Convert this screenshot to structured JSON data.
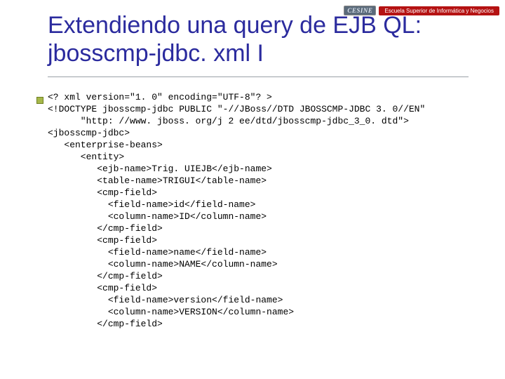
{
  "logo": {
    "badge": "CESINE",
    "strip": "Escuela Superior de Informática y Negocios"
  },
  "title": "Extendiendo una query de EJB QL: jbosscmp-jdbc. xml I",
  "code": {
    "l01": "<? xml version=\"1. 0\" encoding=\"UTF-8\"? >",
    "l02": "<!DOCTYPE jbosscmp-jdbc PUBLIC \"-//JBoss//DTD JBOSSCMP-JDBC 3. 0//EN\"",
    "l03": "      \"http: //www. jboss. org/j 2 ee/dtd/jbosscmp-jdbc_3_0. dtd\">",
    "l04": "<jbosscmp-jdbc>",
    "l05": "   <enterprise-beans>",
    "l06": "      <entity>",
    "l07": "         <ejb-name>Trig. UIEJB</ejb-name>",
    "l08": "         <table-name>TRIGUI</table-name>",
    "l09": "         <cmp-field>",
    "l10": "           <field-name>id</field-name>",
    "l11": "           <column-name>ID</column-name>",
    "l12": "         </cmp-field>",
    "l13": "         <cmp-field>",
    "l14": "           <field-name>name</field-name>",
    "l15": "           <column-name>NAME</column-name>",
    "l16": "         </cmp-field>",
    "l17": "         <cmp-field>",
    "l18": "           <field-name>version</field-name>",
    "l19": "           <column-name>VERSION</column-name>",
    "l20": "         </cmp-field>"
  }
}
